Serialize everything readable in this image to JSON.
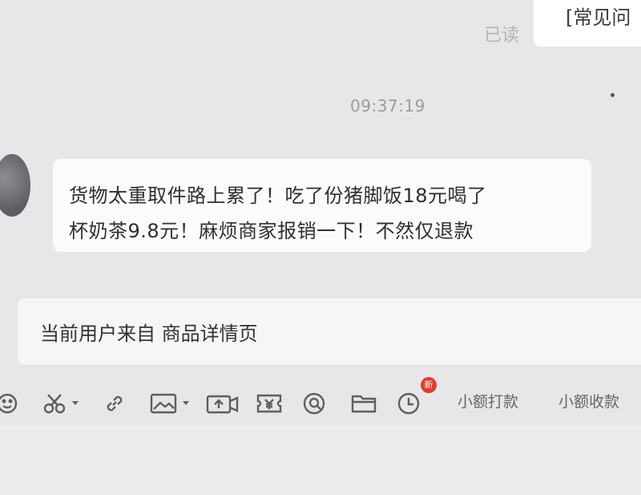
{
  "chat": {
    "previous_message_fragment": "[常见问",
    "read_status": "已读",
    "timestamp": "09:37:19",
    "message_lines": [
      "货物太重取件路上累了！吃了份猪脚饭18元喝了",
      "杯奶茶9.8元！麻烦商家报销一下！不然仅退款"
    ],
    "source_notice": "当前用户来自 商品详情页"
  },
  "toolbar": {
    "icons": [
      "emoji-icon",
      "scissors-icon",
      "link-icon",
      "image-icon",
      "video-icon",
      "coupon-icon",
      "refund-icon",
      "folder-icon",
      "clock-icon"
    ],
    "badge_text": "新",
    "small_pay_label": "小额打款",
    "small_collect_label": "小额收款"
  },
  "colors": {
    "background": "#e7e7e9",
    "bubble": "#fbfbfb",
    "badge": "#e23b2e",
    "icon": "#5f5f62"
  }
}
